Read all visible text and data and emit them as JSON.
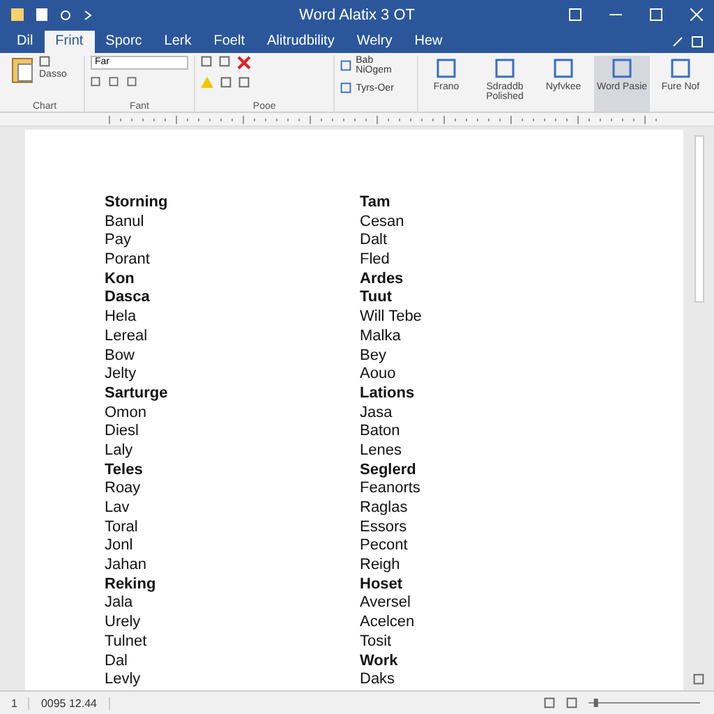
{
  "window": {
    "title": "Word Alatix 3 OT"
  },
  "tabs": [
    {
      "label": "Dil",
      "selected": false
    },
    {
      "label": "Frint",
      "selected": true
    },
    {
      "label": "Sporc",
      "selected": false
    },
    {
      "label": "Lerk",
      "selected": false
    },
    {
      "label": "Foelt",
      "selected": false
    },
    {
      "label": "Alitrudbility",
      "selected": false
    },
    {
      "label": "Welry",
      "selected": false
    },
    {
      "label": "Hew",
      "selected": false
    }
  ],
  "ribbon": {
    "clipboard": {
      "label": "Chart",
      "item": "Dasso"
    },
    "font": {
      "label": "Fant",
      "font_name": "Far"
    },
    "paragraph": {
      "label": "Pooe"
    },
    "styles": [
      "Bab NiOgem",
      "Tyrs-Oer"
    ],
    "buttons": [
      {
        "label": "Frano",
        "selected": false
      },
      {
        "label": "Sdraddb Polished",
        "selected": false
      },
      {
        "label": "Nyfvkee",
        "selected": false
      },
      {
        "label": "Word Pasie",
        "selected": true
      },
      {
        "label": "Fure Nof",
        "selected": false
      }
    ]
  },
  "document": {
    "rows": [
      {
        "left": {
          "text": "Storning",
          "bold": true
        },
        "right": {
          "text": "Tam",
          "bold": true
        }
      },
      {
        "left": {
          "text": "Banul",
          "bold": false
        },
        "right": {
          "text": "Cesan",
          "bold": false
        }
      },
      {
        "left": {
          "text": "Pay",
          "bold": false
        },
        "right": {
          "text": "Dalt",
          "bold": false
        }
      },
      {
        "left": {
          "text": "Porant",
          "bold": false
        },
        "right": {
          "text": "Fled",
          "bold": false
        }
      },
      {
        "left": {
          "text": "Kon",
          "bold": true
        },
        "right": {
          "text": "Ardes",
          "bold": true
        }
      },
      {
        "left": {
          "text": "Dasca",
          "bold": true
        },
        "right": {
          "text": "Tuut",
          "bold": true
        }
      },
      {
        "left": {
          "text": "Hela",
          "bold": false
        },
        "right": {
          "text": "Will Tebe",
          "bold": false
        }
      },
      {
        "left": {
          "text": "Lereal",
          "bold": false
        },
        "right": {
          "text": "Malka",
          "bold": false
        }
      },
      {
        "left": {
          "text": "Bow",
          "bold": false
        },
        "right": {
          "text": "Bey",
          "bold": false
        }
      },
      {
        "left": {
          "text": "Jelty",
          "bold": false
        },
        "right": {
          "text": "Aouo",
          "bold": false
        }
      },
      {
        "left": {
          "text": "Sarturge",
          "bold": true
        },
        "right": {
          "text": "Lations",
          "bold": true
        }
      },
      {
        "left": {
          "text": "Omon",
          "bold": false
        },
        "right": {
          "text": "Jasa",
          "bold": false
        }
      },
      {
        "left": {
          "text": "Diesl",
          "bold": false
        },
        "right": {
          "text": "Baton",
          "bold": false
        }
      },
      {
        "left": {
          "text": "Laly",
          "bold": false
        },
        "right": {
          "text": "Lenes",
          "bold": false
        }
      },
      {
        "left": {
          "text": "Teles",
          "bold": true
        },
        "right": {
          "text": "Seglerd",
          "bold": true
        }
      },
      {
        "left": {
          "text": "Roay",
          "bold": false
        },
        "right": {
          "text": "Feanorts",
          "bold": false
        }
      },
      {
        "left": {
          "text": "Lav",
          "bold": false
        },
        "right": {
          "text": "Raglas",
          "bold": false
        }
      },
      {
        "left": {
          "text": "Toral",
          "bold": false
        },
        "right": {
          "text": "Essors",
          "bold": false
        }
      },
      {
        "left": {
          "text": "Jonl",
          "bold": false
        },
        "right": {
          "text": "Pecont",
          "bold": false
        }
      },
      {
        "left": {
          "text": "Jahan",
          "bold": false
        },
        "right": {
          "text": "Reigh",
          "bold": false
        }
      },
      {
        "left": {
          "text": "Reking",
          "bold": true
        },
        "right": {
          "text": "Hoset",
          "bold": true
        }
      },
      {
        "left": {
          "text": "Jala",
          "bold": false
        },
        "right": {
          "text": "Aversel",
          "bold": false
        }
      },
      {
        "left": {
          "text": "Urely",
          "bold": false
        },
        "right": {
          "text": "Acelcen",
          "bold": false
        }
      },
      {
        "left": {
          "text": "Tulnet",
          "bold": false
        },
        "right": {
          "text": "Tosit",
          "bold": false
        }
      },
      {
        "left": {
          "text": "Dal",
          "bold": false
        },
        "right": {
          "text": "Work",
          "bold": true
        }
      },
      {
        "left": {
          "text": "Levly",
          "bold": false
        },
        "right": {
          "text": "Daks",
          "bold": false
        }
      }
    ]
  },
  "status_bar": {
    "page": "1",
    "words": "0095 12.44",
    "zoom": {
      "level": 0.05
    }
  }
}
